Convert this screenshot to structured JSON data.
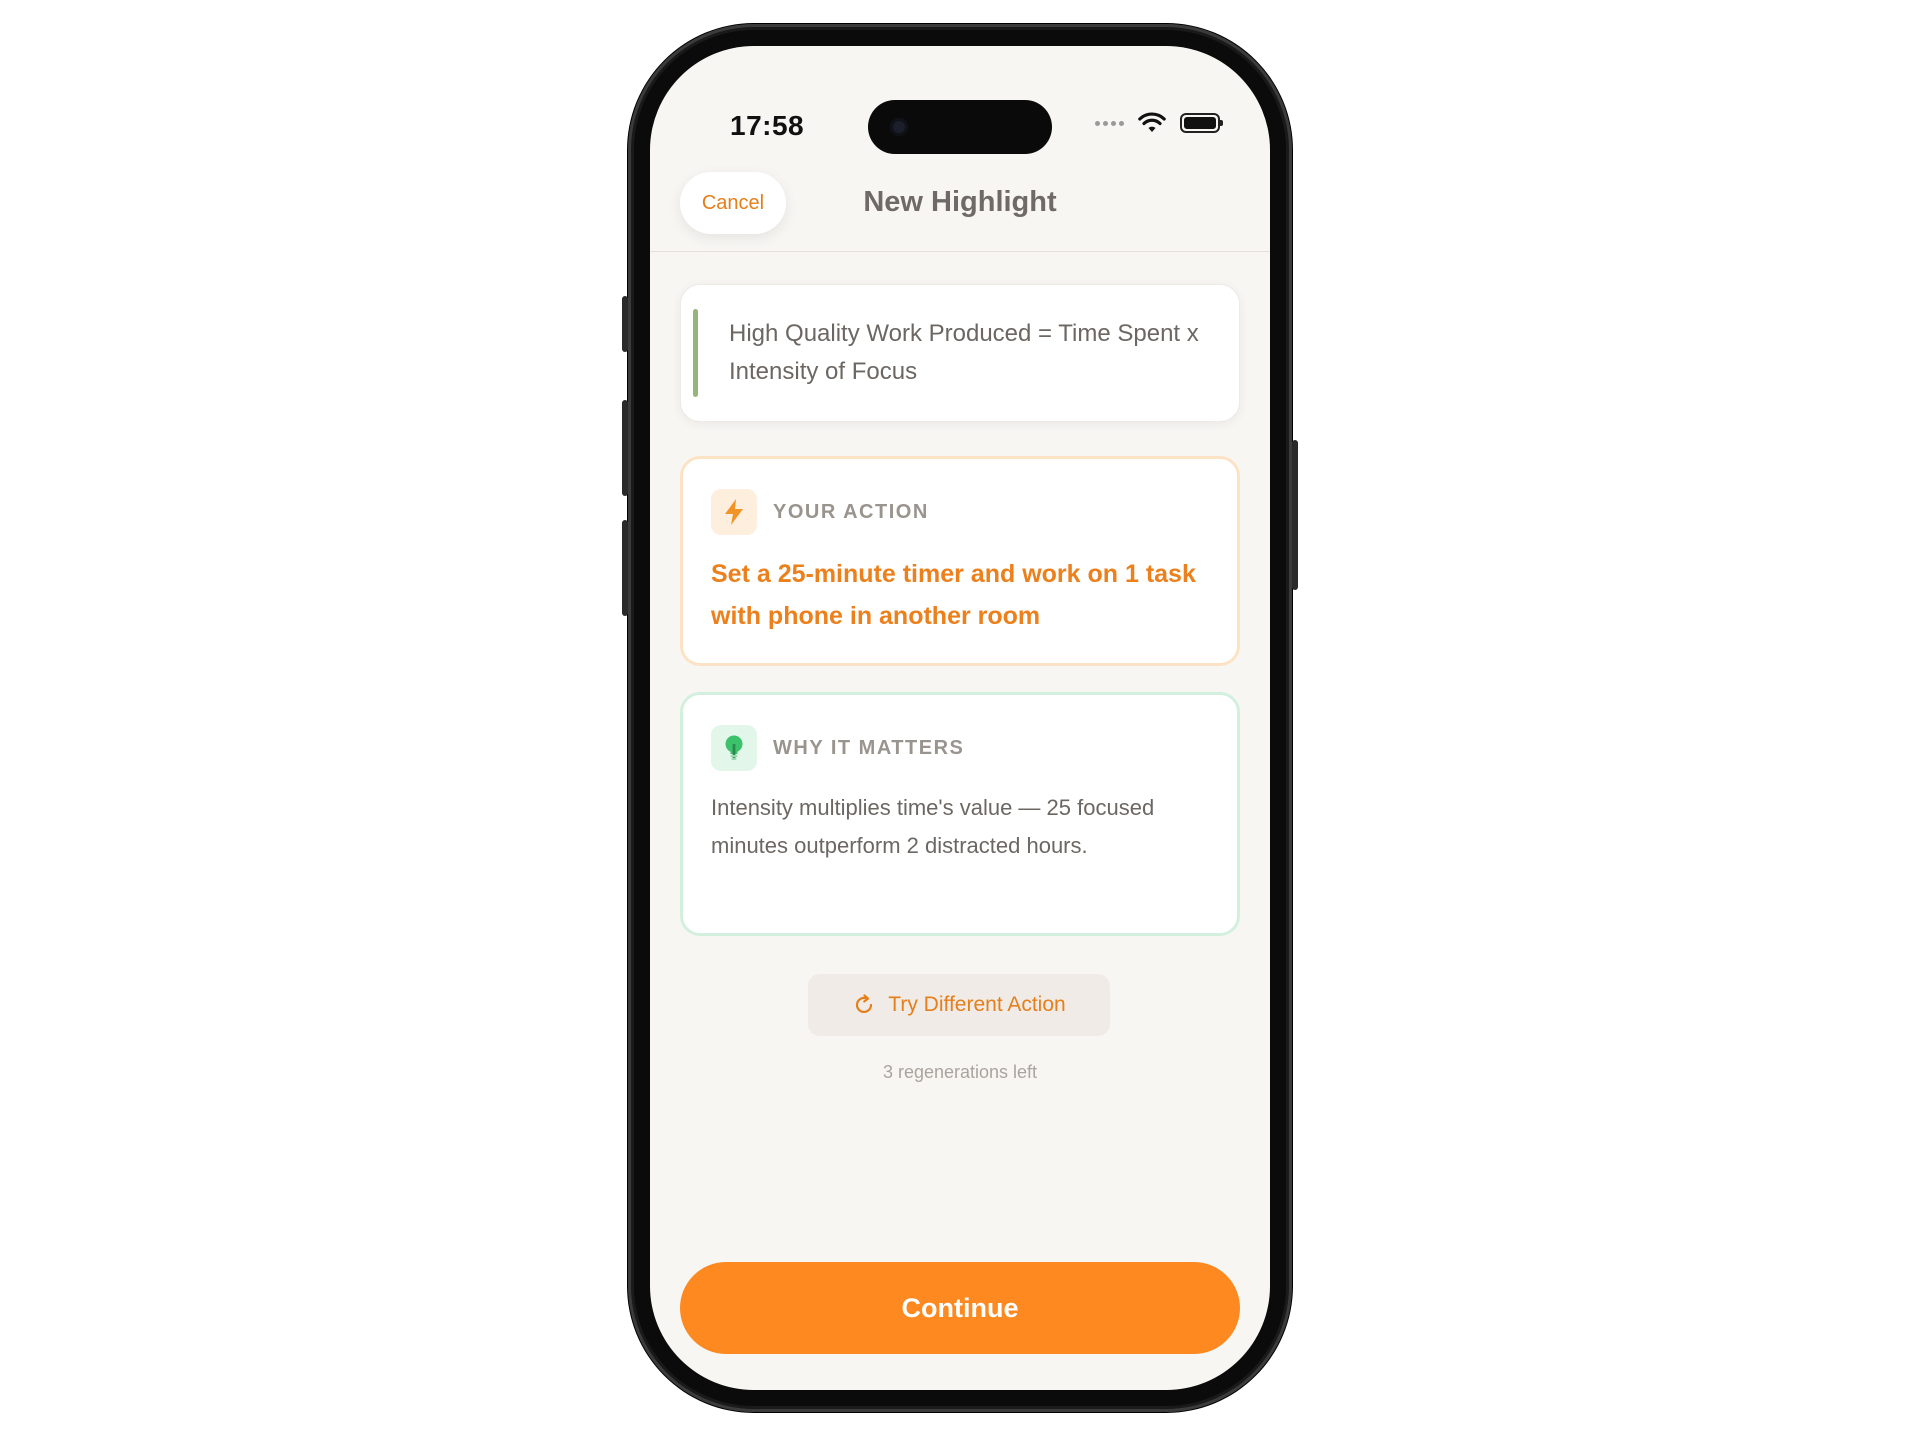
{
  "status_bar": {
    "time": "17:58"
  },
  "header": {
    "cancel_label": "Cancel",
    "title": "New Highlight"
  },
  "highlight": {
    "quote": "High Quality Work Produced = Time Spent x Intensity of Focus",
    "accent_color": "#95b57a"
  },
  "action_card": {
    "icon": "lightning-bolt-icon",
    "label": "YOUR ACTION",
    "text": "Set a 25-minute timer and work on 1 task with phone in another room",
    "accent_color": "#ec801c"
  },
  "matters_card": {
    "icon": "lightbulb-icon",
    "label": "WHY IT MATTERS",
    "text": "Intensity multiplies time's value — 25 focused minutes outperform 2 distracted hours.",
    "accent_color": "#3cc26b"
  },
  "regenerate": {
    "icon": "refresh-icon",
    "button_label": "Try Different Action",
    "note": "3 regenerations left"
  },
  "footer": {
    "continue_label": "Continue",
    "button_color": "#fd8920"
  }
}
